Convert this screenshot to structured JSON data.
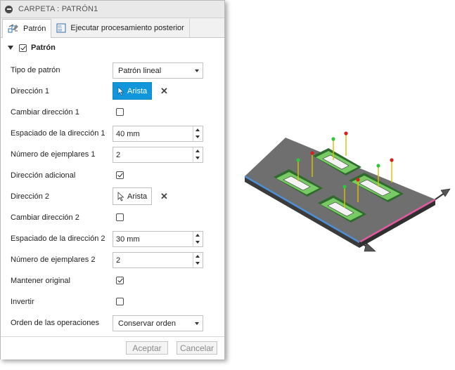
{
  "dialog": {
    "title": "CARPETA : PATRÓN1",
    "tabs": [
      {
        "label": "Patrón",
        "icon": "pattern-icon",
        "active": true
      },
      {
        "label": "Ejecutar procesamiento posterior",
        "icon": "postprocess-icon",
        "active": false
      }
    ],
    "section": {
      "label": "Patrón",
      "checked": true
    },
    "fields": {
      "pattern_type": {
        "label": "Tipo de patrón",
        "value": "Patrón lineal"
      },
      "direction1": {
        "label": "Dirección 1",
        "value": "Arista",
        "active": true
      },
      "flip_direction1": {
        "label": "Cambiar dirección 1",
        "checked": false
      },
      "spacing1": {
        "label": "Espaciado de la dirección 1",
        "value": "40 mm"
      },
      "count1": {
        "label": "Número de ejemplares 1",
        "value": "2"
      },
      "additional_direction": {
        "label": "Dirección adicional",
        "checked": true
      },
      "direction2": {
        "label": "Dirección 2",
        "value": "Arista",
        "active": false
      },
      "flip_direction2": {
        "label": "Cambiar dirección 2",
        "checked": false
      },
      "spacing2": {
        "label": "Espaciado de la dirección 2",
        "value": "30 mm"
      },
      "count2": {
        "label": "Número de ejemplares 2",
        "value": "2"
      },
      "keep_original": {
        "label": "Mantener original",
        "checked": true
      },
      "invert": {
        "label": "Invertir",
        "checked": false
      },
      "operation_order": {
        "label": "Orden de las operaciones",
        "value": "Conservar orden"
      }
    },
    "buttons": {
      "ok": "Aceptar",
      "cancel": "Cancelar"
    }
  },
  "colors": {
    "accent": "#1296db",
    "plate_top": "#6f6f6f",
    "edge_blue": "#4e8fd6",
    "edge_pink": "#e05a9f",
    "pocket_green": "#3cc34a"
  }
}
